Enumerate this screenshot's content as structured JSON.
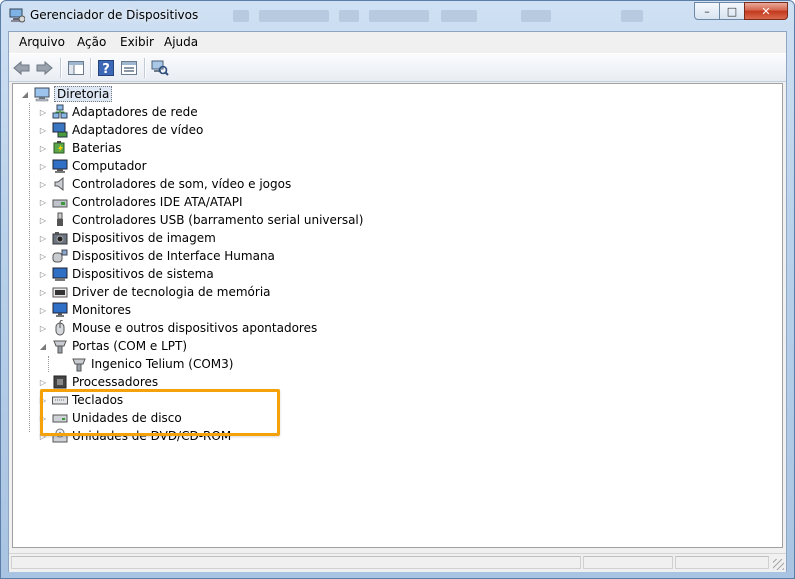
{
  "window": {
    "title": "Gerenciador de Dispositivos",
    "caption_buttons": {
      "minimize": "–",
      "maximize": "□",
      "close": "✕"
    }
  },
  "menu": [
    "Arquivo",
    "Ação",
    "Exibir",
    "Ajuda"
  ],
  "toolbar": {
    "buttons": [
      "back-icon",
      "forward-icon",
      "show-hide-console-tree-icon",
      "help-icon",
      "properties-icon",
      "scan-hardware-icon"
    ]
  },
  "tree": {
    "root": {
      "label": "Diretoria",
      "icon": "computer-icon",
      "expanded": true
    },
    "categories": [
      {
        "label": "Adaptadores de rede",
        "icon": "network-adapter-icon",
        "expanded": false
      },
      {
        "label": "Adaptadores de vídeo",
        "icon": "display-adapter-icon",
        "expanded": false
      },
      {
        "label": "Baterias",
        "icon": "battery-icon",
        "expanded": false
      },
      {
        "label": "Computador",
        "icon": "computer-icon",
        "expanded": false
      },
      {
        "label": "Controladores de som, vídeo e jogos",
        "icon": "speaker-icon",
        "expanded": false
      },
      {
        "label": "Controladores IDE ATA/ATAPI",
        "icon": "ide-controller-icon",
        "expanded": false
      },
      {
        "label": "Controladores USB (barramento serial universal)",
        "icon": "usb-icon",
        "expanded": false
      },
      {
        "label": "Dispositivos de imagem",
        "icon": "camera-icon",
        "expanded": false
      },
      {
        "label": "Dispositivos de Interface Humana",
        "icon": "hid-icon",
        "expanded": false
      },
      {
        "label": "Dispositivos de sistema",
        "icon": "system-device-icon",
        "expanded": false
      },
      {
        "label": "Driver de tecnologia de memória",
        "icon": "memory-icon",
        "expanded": false
      },
      {
        "label": "Monitores",
        "icon": "monitor-icon",
        "expanded": false
      },
      {
        "label": "Mouse e outros dispositivos apontadores",
        "icon": "mouse-icon",
        "expanded": false
      },
      {
        "label": "Portas (COM e LPT)",
        "icon": "port-icon",
        "expanded": true,
        "children": [
          {
            "label": "Ingenico Telium (COM3)",
            "icon": "port-icon"
          }
        ]
      },
      {
        "label": "Processadores",
        "icon": "processor-icon",
        "expanded": false
      },
      {
        "label": "Teclados",
        "icon": "keyboard-icon",
        "expanded": false
      },
      {
        "label": "Unidades de disco",
        "icon": "disk-drive-icon",
        "expanded": false
      },
      {
        "label": "Unidades de DVD/CD-ROM",
        "icon": "dvd-drive-icon",
        "expanded": false
      }
    ]
  },
  "colors": {
    "highlight_box": "#f4a20c",
    "selection": "#dfe9f5",
    "title_bar": "#b9d1ea"
  }
}
